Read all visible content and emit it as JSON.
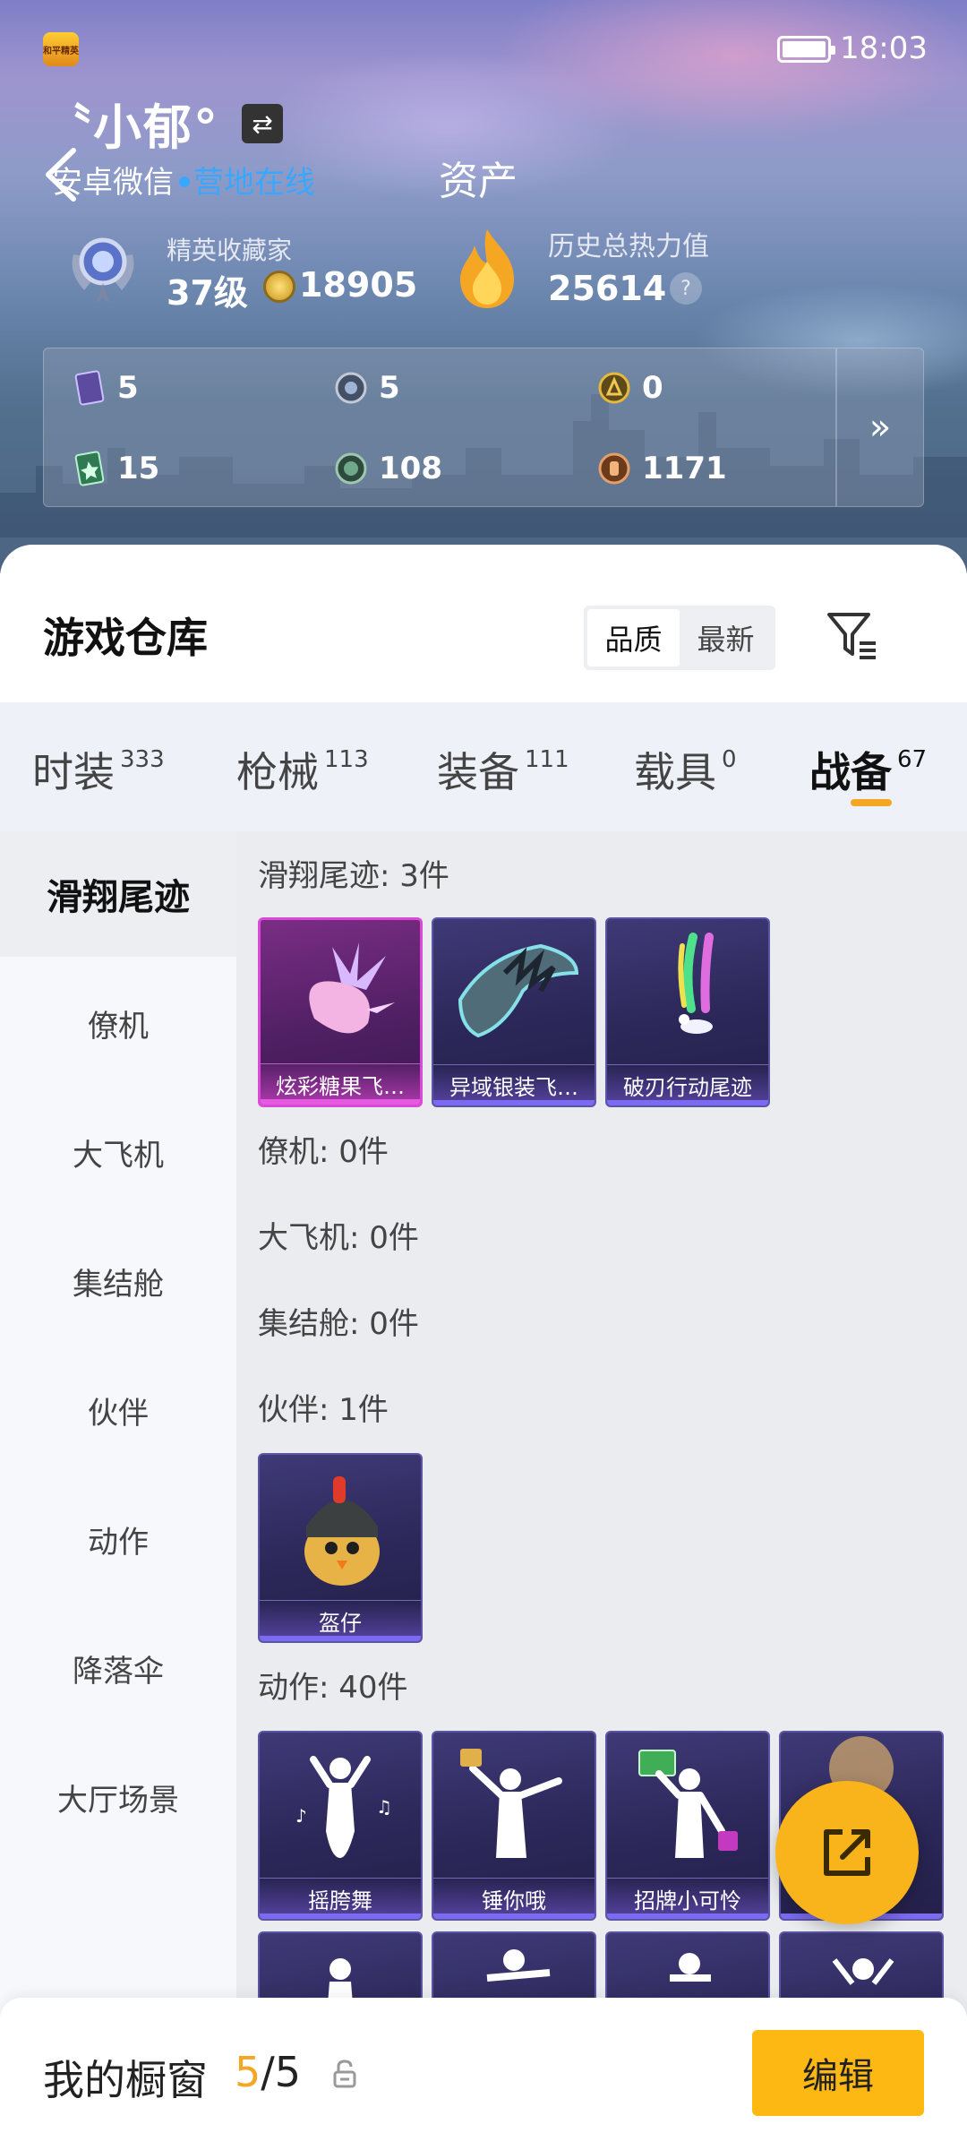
{
  "status_bar": {
    "time": "18:03",
    "app_badge": "和平精英"
  },
  "profile": {
    "username": "〝小郁°",
    "platform": "安卓微信",
    "online_status": "营地在线",
    "page_title": "资产"
  },
  "elite": {
    "title": "精英收藏家",
    "level": "37级",
    "coins": "18905"
  },
  "heat": {
    "title": "历史总热力值",
    "value": "25614",
    "help": "?"
  },
  "resources": [
    {
      "icon": "purple-card-icon",
      "value": "5"
    },
    {
      "icon": "silver-badge-icon",
      "value": "5"
    },
    {
      "icon": "gold-badge-icon",
      "value": "0"
    },
    {
      "icon": "green-card-icon",
      "value": "15"
    },
    {
      "icon": "green-coin-icon",
      "value": "108"
    },
    {
      "icon": "bronze-coin-icon",
      "value": "1171"
    }
  ],
  "warehouse": {
    "title": "游戏仓库",
    "sort_options": [
      "品质",
      "最新"
    ],
    "active_sort": "品质"
  },
  "tabs": [
    {
      "label": "时装",
      "count": "333"
    },
    {
      "label": "枪械",
      "count": "113"
    },
    {
      "label": "装备",
      "count": "111"
    },
    {
      "label": "载具",
      "count": "0"
    },
    {
      "label": "战备",
      "count": "67"
    }
  ],
  "active_tab": "战备",
  "sidebar": [
    "滑翔尾迹",
    "僚机",
    "大飞机",
    "集结舱",
    "伙伴",
    "动作",
    "降落伞",
    "大厅场景"
  ],
  "sections": [
    {
      "label": "滑翔尾迹: 3件",
      "items": [
        "炫彩糖果飞…",
        "异域银装飞…",
        "破刃行动尾迹"
      ]
    },
    {
      "label": "僚机: 0件",
      "items": []
    },
    {
      "label": "大飞机: 0件",
      "items": []
    },
    {
      "label": "集结舱: 0件",
      "items": []
    },
    {
      "label": "伙伴: 1件",
      "items": [
        "盔仔"
      ]
    },
    {
      "label": "动作: 40件",
      "items": [
        "摇胯舞",
        "锤你哦",
        "招牌小可怜"
      ]
    }
  ],
  "showcase": {
    "label": "我的橱窗",
    "current": "5",
    "total": "/5",
    "edit_label": "编辑"
  },
  "colors": {
    "accent": "#fdb813",
    "online": "#3aa7ff",
    "rare_border": "#d94bd6",
    "card_bg": "#2b2758"
  }
}
